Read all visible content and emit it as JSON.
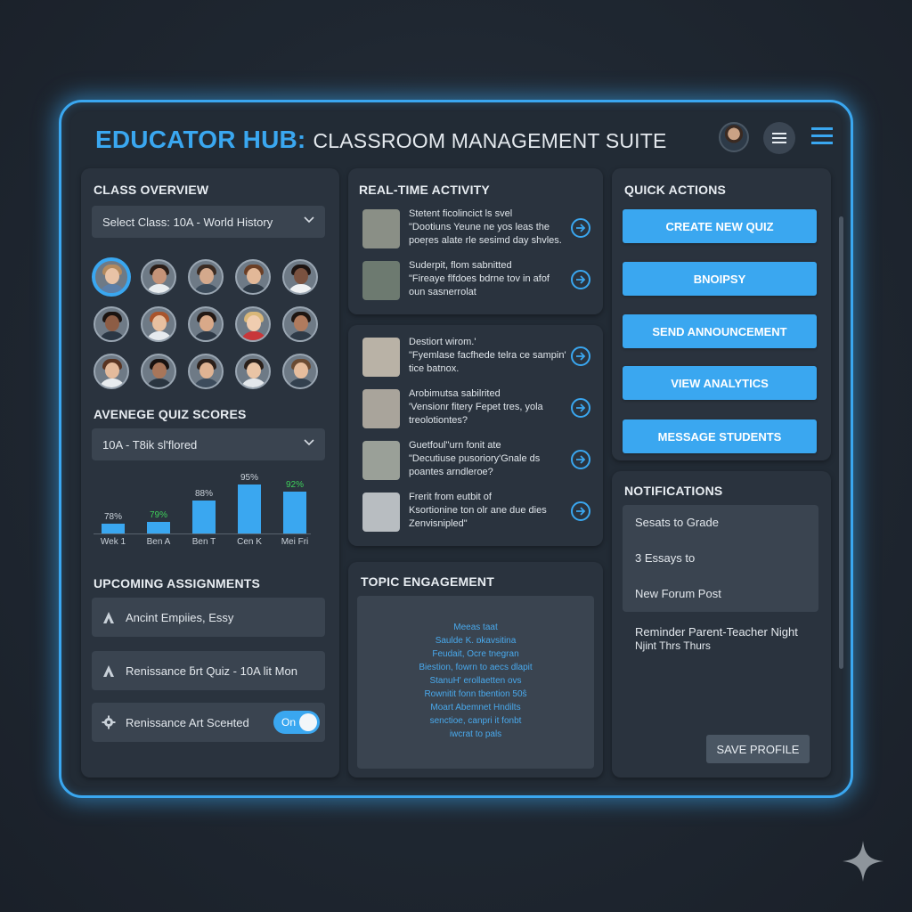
{
  "header": {
    "brand": "EDUCATOR HUB:",
    "title_rest": "CLASSROOM MANAGEMENT SUITE"
  },
  "class_overview": {
    "title": "CLASS OVERVIEW",
    "select_value": "Select Class: 10A - World History",
    "students": [
      {
        "skin": "#e8c3a6",
        "hair": "#b38a5e",
        "shirt": "#5c7fa8",
        "selected": true
      },
      {
        "skin": "#c59378",
        "hair": "#2a1d17",
        "shirt": "#e9edf0"
      },
      {
        "skin": "#d4a98c",
        "hair": "#3b2b22",
        "shirt": "#3c4b5a"
      },
      {
        "skin": "#e2b898",
        "hair": "#6b3f26",
        "shirt": "#2e3a46"
      },
      {
        "skin": "#7a5240",
        "hair": "#1c1412",
        "shirt": "#f0f2f4"
      },
      {
        "skin": "#8d5d45",
        "hair": "#1a1310",
        "shirt": "#2b3744"
      },
      {
        "skin": "#e8c0a0",
        "hair": "#a9542c",
        "shirt": "#e6eaee"
      },
      {
        "skin": "#d9a989",
        "hair": "#231915",
        "shirt": "#2e3946"
      },
      {
        "skin": "#f0cdb0",
        "hair": "#d9b779",
        "shirt": "#c8373a"
      },
      {
        "skin": "#b07b5e",
        "hair": "#1d1511",
        "shirt": "#2f3b48"
      },
      {
        "skin": "#e4bb9c",
        "hair": "#5a3522",
        "shirt": "#e8ecef"
      },
      {
        "skin": "#a8765a",
        "hair": "#181210",
        "shirt": "#2a3540"
      },
      {
        "skin": "#dfb393",
        "hair": "#2c201a",
        "shirt": "#3d4c5c"
      },
      {
        "skin": "#e9c4a5",
        "hair": "#2a1f19",
        "shirt": "#e3e7eb"
      },
      {
        "skin": "#e6bd9d",
        "hair": "#6b4b33",
        "shirt": "#33414f"
      }
    ]
  },
  "quiz_scores": {
    "title": "AVENEGE QUIZ SCORES",
    "select_value": "10A - T8ik sl'flored"
  },
  "chart_data": {
    "type": "bar",
    "categories": [
      "Wek 1",
      "Ben A",
      "Ben T",
      "Cen K",
      "Mei Fri"
    ],
    "values": [
      78,
      79,
      88,
      95,
      92
    ],
    "value_labels": [
      "78%",
      "79%",
      "88%",
      "95%",
      "92%"
    ],
    "xlabel": "",
    "ylabel": "",
    "ylim": [
      74,
      96
    ],
    "grid": false,
    "label_colors": {
      "high": "#3ecf5a",
      "normal": "#c9d1d9"
    },
    "bar_color": "#3aa7f0"
  },
  "assignments": {
    "title": "UPCOMING ASSIGNMENTS",
    "items": [
      {
        "label": "Ancint Empiies, Essy",
        "icon": "a-icon"
      },
      {
        "label": "Renissance ƃrt Quiz - 10A lit Mon",
        "icon": "a-icon"
      },
      {
        "label": "Renissance Art Sceнted",
        "icon": "gear-icon",
        "toggle": "On"
      }
    ]
  },
  "activity": {
    "title": "REAL-TIME ACTIVITY",
    "top_items": [
      {
        "lines": [
          "Stetent ficolincict ls svel",
          "\"Dootiuns Yeune ne yos leas the",
          "poeŗes alate rle sesimd day shvles."
        ],
        "skin": "#7a5240",
        "hair": "#1c1412",
        "bg": "#8a8f86"
      },
      {
        "lines": [
          "Suderpit, flom sabnitted",
          "\"Fireaye flfdoes bdrne tov in afof",
          "oun sasnerrolat"
        ],
        "skin": "#d4a98c",
        "hair": "#3b2b22",
        "bg": "#6d7a70"
      }
    ],
    "bottom_items": [
      {
        "lines": [
          "Destiort wirom.'",
          "\"Fyemlase facfhede telra ce sampin'",
          "tice batnox."
        ],
        "skin": "#c59378",
        "hair": "#2a1d17",
        "bg": "#b9b2a6"
      },
      {
        "lines": [
          "Arobimutsa sabilrited",
          "'Vensionr fitery Fepet tres, yola",
          "treolotiontes?"
        ],
        "skin": "#7a5240",
        "hair": "#1a1310",
        "bg": "#a9a49b"
      },
      {
        "lines": [
          "Guetfoul\"urn fonit ate",
          "\"Decutiuse pusoriory'Gnale ds",
          "poantes arndleroe?"
        ],
        "skin": "#5e3d2e",
        "hair": "#140e0c",
        "bg": "#9aa098"
      },
      {
        "lines": [
          "Frerit from eutbit of",
          "Ksortionine ton olr ane due dies",
          "Zenvisnipled\""
        ],
        "skin": "#e2b898",
        "hair": "#8a6a4a",
        "bg": "#b8bdc1"
      }
    ]
  },
  "topic_engagement": {
    "title": "TOPIC ENGAGEMENT",
    "lines": [
      "Meeas taat",
      "Saulde K.   ɒkavsitina",
      "Feudait, Ocre tnegran",
      "Biestion, fowrn to aecs dlapit",
      "StanuH' erollaetten ovs",
      "Rownitit fonn tbention 50ŝ",
      "Moart Abemnet Hndilts",
      "senctioe, canpri it fonbt",
      "iwcrat to pals"
    ]
  },
  "quick_actions": {
    "title": "QUICK ACTIONS",
    "buttons": [
      "CREATE NEW QUIZ",
      "BNOIPSY",
      "SEND ANNOUNCEMENT",
      "VIEW ANALYTICS",
      "MESSAGE STUDENTS"
    ]
  },
  "notifications": {
    "title": "NOTIFICATIONS",
    "items": [
      "Sesats to Grade",
      "3 Essays to",
      "New Forum Post"
    ],
    "reminder_lines": [
      "Reminder Parent-Teacher Night",
      "Njint Thrs Thurs"
    ],
    "save_label": "SAVE PROFILE"
  },
  "colors": {
    "accent": "#3aa7f0",
    "panel": "#2a333e",
    "field": "#3a4450",
    "frame_glow": "#3aa7f0"
  }
}
